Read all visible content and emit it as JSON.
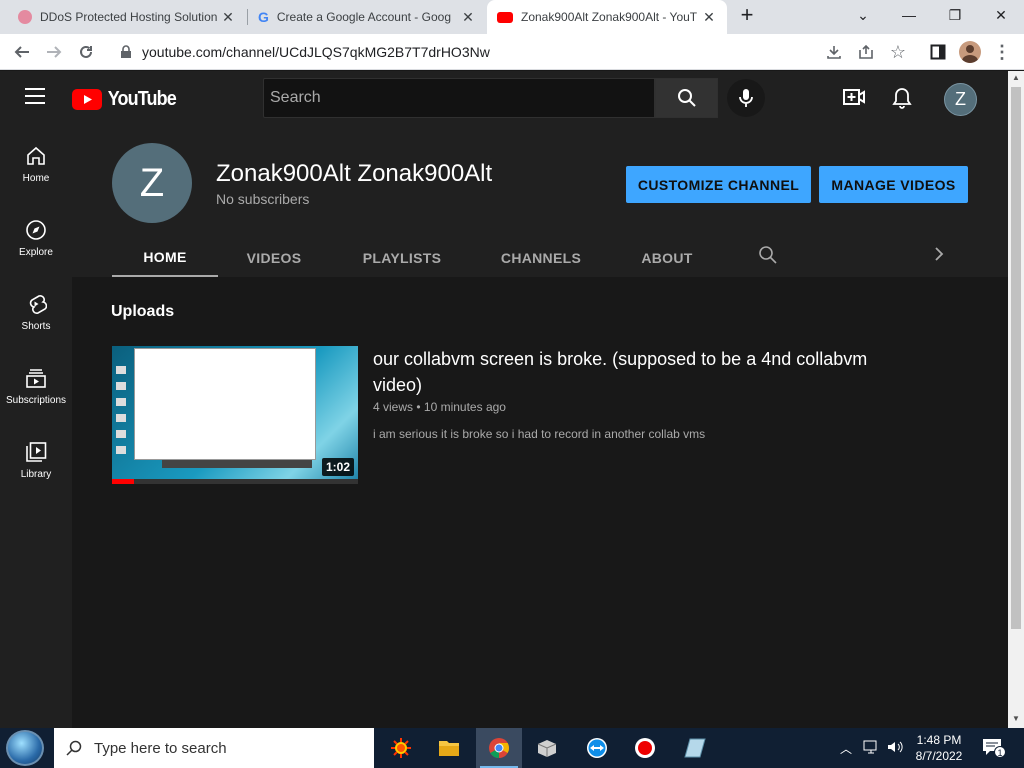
{
  "browser": {
    "tabs": [
      {
        "title": "DDoS Protected Hosting Solution",
        "icon": "ddos-favicon"
      },
      {
        "title": "Create a Google Account - Goog",
        "icon": "google-favicon"
      },
      {
        "title": "Zonak900Alt Zonak900Alt - YouT",
        "icon": "youtube-favicon"
      }
    ],
    "url": "youtube.com/channel/UCdJLQS7qkMG2B7T7drHO3Nw"
  },
  "youtube": {
    "logo_text": "YouTube",
    "search_placeholder": "Search",
    "account_initial": "Z",
    "sidebar": [
      {
        "label": "Home",
        "icon": "home-icon"
      },
      {
        "label": "Explore",
        "icon": "compass-icon"
      },
      {
        "label": "Shorts",
        "icon": "shorts-icon"
      },
      {
        "label": "Subscriptions",
        "icon": "subscriptions-icon"
      },
      {
        "label": "Library",
        "icon": "library-icon"
      }
    ],
    "channel": {
      "avatar_initial": "Z",
      "name": "Zonak900Alt Zonak900Alt",
      "subscribers": "No subscribers",
      "customize_label": "CUSTOMIZE CHANNEL",
      "manage_label": "MANAGE VIDEOS",
      "tabs": [
        "HOME",
        "VIDEOS",
        "PLAYLISTS",
        "CHANNELS",
        "ABOUT"
      ]
    },
    "uploads": {
      "heading": "Uploads",
      "video": {
        "title": "our collabvm screen is broke. (supposed to be a 4nd collabvm video)",
        "views": "4 views",
        "age": "10 minutes ago",
        "description": "i am serious it is broke so i had to record in another collab vms",
        "duration": "1:02"
      }
    }
  },
  "taskbar": {
    "search_placeholder": "Type here to search",
    "time": "1:48 PM",
    "date": "8/7/2022",
    "notification_count": "1"
  },
  "colors": {
    "accent": "#3ea6ff",
    "youtube_red": "#ff0000",
    "taskbar": "#101f33"
  }
}
